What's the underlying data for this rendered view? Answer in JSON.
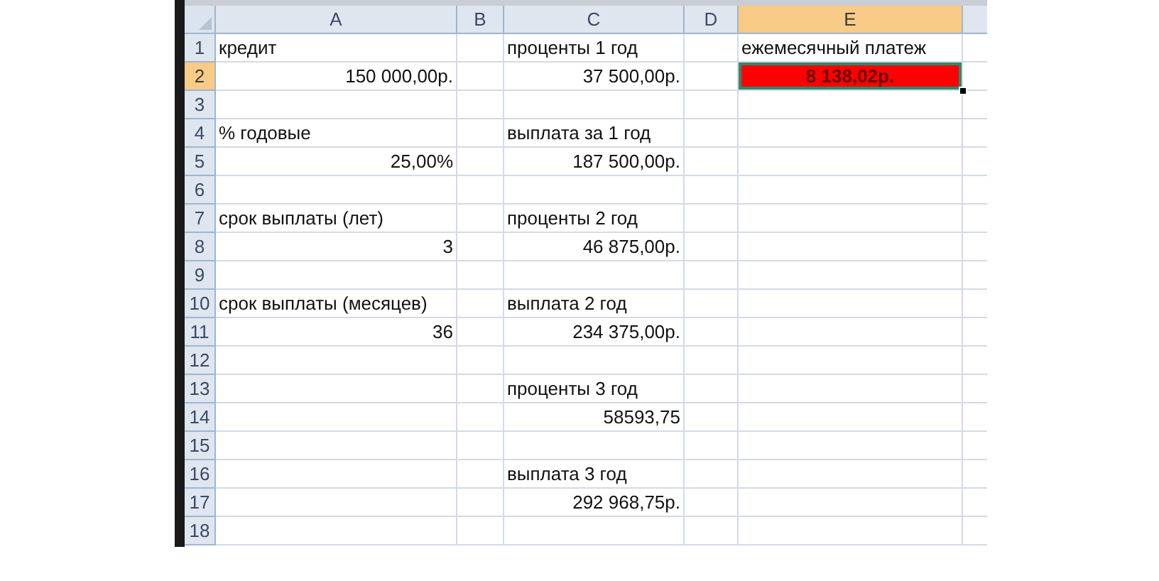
{
  "columns": [
    {
      "label": "A",
      "selected": false
    },
    {
      "label": "B",
      "selected": false
    },
    {
      "label": "C",
      "selected": false
    },
    {
      "label": "D",
      "selected": false
    },
    {
      "label": "E",
      "selected": true
    }
  ],
  "rows": [
    {
      "label": "1",
      "selected": false,
      "kind": "label",
      "cells": {
        "a": "кредит",
        "c": "проценты 1 год",
        "e": "ежемесячный платеж"
      }
    },
    {
      "label": "2",
      "selected": true,
      "kind": "value",
      "cells": {
        "a": "150 000,00р.",
        "c": "37 500,00р.",
        "e": {
          "text": "8 138,02р.",
          "color": "#ff0000",
          "selected": true
        }
      }
    },
    {
      "label": "3",
      "selected": false,
      "kind": "label",
      "cells": {}
    },
    {
      "label": "4",
      "selected": false,
      "kind": "label",
      "cells": {
        "a": "% годовые",
        "c": "выплата за 1 год"
      }
    },
    {
      "label": "5",
      "selected": false,
      "kind": "value",
      "cells": {
        "a": "25,00%",
        "c": "187 500,00р."
      }
    },
    {
      "label": "6",
      "selected": false,
      "kind": "label",
      "cells": {}
    },
    {
      "label": "7",
      "selected": false,
      "kind": "label",
      "cells": {
        "a": "срок выплаты (лет)",
        "c": "проценты 2 год"
      }
    },
    {
      "label": "8",
      "selected": false,
      "kind": "value",
      "cells": {
        "a": "3",
        "c": "46 875,00р."
      }
    },
    {
      "label": "9",
      "selected": false,
      "kind": "label",
      "cells": {}
    },
    {
      "label": "10",
      "selected": false,
      "kind": "label",
      "cells": {
        "a": "срок выплаты (месяцев)",
        "c": "выплата 2 год"
      }
    },
    {
      "label": "11",
      "selected": false,
      "kind": "value",
      "cells": {
        "a": "36",
        "c": "234 375,00р."
      }
    },
    {
      "label": "12",
      "selected": false,
      "kind": "label",
      "cells": {}
    },
    {
      "label": "13",
      "selected": false,
      "kind": "label",
      "cells": {
        "c": "проценты 3 год"
      }
    },
    {
      "label": "14",
      "selected": false,
      "kind": "value",
      "cells": {
        "c": "58593,75"
      }
    },
    {
      "label": "15",
      "selected": false,
      "kind": "label",
      "cells": {}
    },
    {
      "label": "16",
      "selected": false,
      "kind": "label",
      "cells": {
        "c": "выплата 3 год"
      }
    },
    {
      "label": "17",
      "selected": false,
      "kind": "value",
      "cells": {
        "c": "292 968,75р."
      }
    },
    {
      "label": "18",
      "selected": false,
      "kind": "label",
      "cells": {}
    }
  ]
}
